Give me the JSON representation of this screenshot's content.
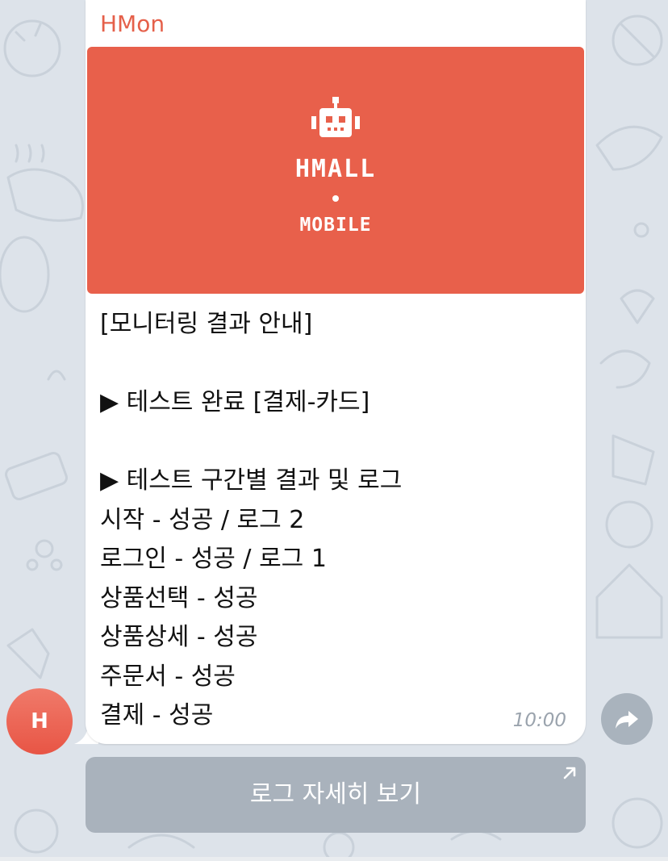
{
  "message": {
    "sender": "HMon",
    "banner": {
      "line1": "HMALL",
      "line2": "MOBILE",
      "icon": "robot-icon",
      "background": "#e8604b"
    },
    "lines": [
      "[모니터링 결과 안내]",
      "",
      "▶ 테스트 완료 [결제-카드]",
      "",
      "▶ 테스트 구간별 결과 및 로그",
      "시작 - 성공 / 로그 2",
      "로그인 - 성공 / 로그 1",
      "상품선택 - 성공",
      "상품상세 - 성공",
      "주문서 - 성공",
      "결제 - 성공"
    ],
    "time": "10:00"
  },
  "avatar": {
    "initial": "H"
  },
  "share_icon": "share-arrow-icon",
  "inline_button": {
    "label": "로그 자세히 보기",
    "icon": "external-link-arrow-icon"
  },
  "colors": {
    "accent": "#e5604a",
    "chat_background": "#dde3ea",
    "button_background": "#a9b2bc"
  }
}
